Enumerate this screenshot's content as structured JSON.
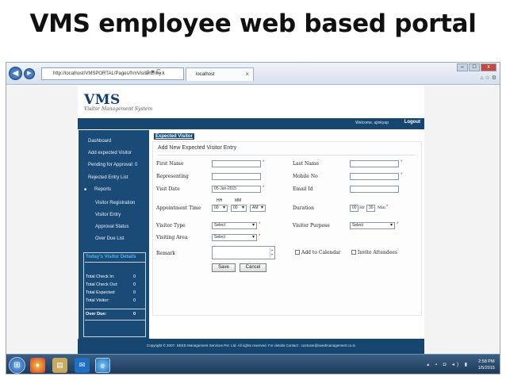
{
  "slide": {
    "title": "VMS employee web based portal"
  },
  "browser": {
    "url": "http://localhost/VMSPORTAL/Pages/frmVisitorEntry.k",
    "tab_title": "localhost",
    "tab_close": "×",
    "back_icon": "back-arrow-icon",
    "forward_icon": "forward-arrow-icon",
    "addr_icons": "ρ ▾ C",
    "window_controls": [
      "–",
      "□",
      "x"
    ],
    "right_icons": "⌂ ☆ ⚙"
  },
  "header": {
    "logo_main": "VMS",
    "logo_sub": "Visitor Management System",
    "welcome": "Welcome, ajinkyap",
    "logout": "Logout"
  },
  "sidebar": {
    "items": [
      "Dashboard",
      "Add expected Visitor",
      "Pending for Approval: 0",
      "Rejected Entry List",
      "Reports",
      "Visitor Registration",
      "Visitor Entry",
      "Approval Status",
      "Over Due List"
    ],
    "details_title": "Today's Visitor Details",
    "details": [
      {
        "label": "Total Check In:",
        "value": "0"
      },
      {
        "label": "Total Check Out:",
        "value": "0"
      },
      {
        "label": "Total Expected:",
        "value": "0"
      },
      {
        "label": "Total Visitor:",
        "value": "0"
      }
    ],
    "overdue": {
      "label": "Over Due:",
      "value": "0"
    }
  },
  "form": {
    "breadcrumb": "Expected Visitor",
    "section_title": "Add New Expected Visitor Entry",
    "required_mark": "*",
    "first_name_label": "First Name",
    "last_name_label": "Last Name",
    "representing_label": "Representing",
    "mobile_label": "Mobile No",
    "visit_date_label": "Visit Date",
    "visit_date_value": "05-Jan-2015",
    "email_label": "Email Id",
    "appointment_label": "Appointment Time",
    "hh_label": "HH",
    "mm_label": "MM",
    "hh_value": "00",
    "mm_value": "00",
    "ampm_value": "AM",
    "time_colon": ":",
    "duration_label": "Duration",
    "duration_hr_value": "00",
    "duration_hr_unit": "Hr",
    "duration_min_value": "30",
    "duration_min_unit": "Min",
    "visitor_type_label": "Visitor Type",
    "visitor_type_value": "Select",
    "visitor_purpose_label": "Visitor Purpose",
    "visitor_purpose_value": "Select",
    "visiting_area_label": "Visiting Area",
    "visiting_area_value": "Select",
    "remark_label": "Remark",
    "add_calendar_label": "Add to Calendar",
    "invite_label": "Invite Attendees",
    "save_label": "Save",
    "cancel_label": "Cancel"
  },
  "footer": {
    "text": "Copyright © 2007. SEED Management Services Pvt. Ltd. All rights reserved. For details Contact : custcare@seedmanagement.co.in"
  },
  "taskbar": {
    "tray": "▴ ▪ ◘ ◂) ▮",
    "time": "2:58 PM",
    "date": "1/5/2015"
  }
}
